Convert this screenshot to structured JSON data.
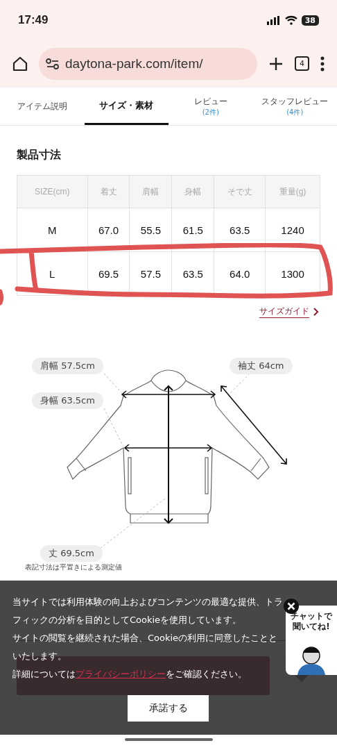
{
  "status_bar": {
    "time": "17:49",
    "battery": "38"
  },
  "browser": {
    "url": "daytona-park.com/item/",
    "tab_count": "4"
  },
  "tabs": [
    {
      "label": "アイテム説明",
      "selected": false
    },
    {
      "label": "サイズ・素材",
      "selected": true
    },
    {
      "label": "レビュー",
      "count": "(2件)",
      "selected": false
    },
    {
      "label": "スタッフレビュー",
      "count": "(4件)",
      "selected": false
    }
  ],
  "section_title": "製品寸法",
  "table": {
    "columns": [
      "SIZE(cm)",
      "着丈",
      "肩幅",
      "身幅",
      "そで丈",
      "重量(g)"
    ],
    "rows": [
      [
        "M",
        "67.0",
        "55.5",
        "61.5",
        "63.5",
        "1240"
      ],
      [
        "L",
        "69.5",
        "57.5",
        "63.5",
        "64.0",
        "1300"
      ]
    ]
  },
  "size_guide_link": "サイズガイド",
  "diagram_labels": [
    {
      "kind": "shoulder",
      "text": "肩幅 57.5cm"
    },
    {
      "kind": "sleeve",
      "text": "袖丈 64cm"
    },
    {
      "kind": "body",
      "text": "身幅 63.5cm"
    },
    {
      "kind": "length",
      "text": "丈 69.5cm"
    }
  ],
  "notes": [
    "表記寸法は平置きによる測定値"
  ],
  "cookie": {
    "lines": [
      "当サイトでは利用体験の向上およびコンテンツの最適な提供、トラフィックの分析を目的としてCookieを使用しています。",
      "サイトの閲覧を継続された場合、Cookieの利用に同意したことといたします。"
    ],
    "detail_before": "詳細については",
    "link": "プライバシーポリシー",
    "detail_after": "をご確認ください。",
    "accept": "承諾する"
  },
  "chat_widget": "チャットで聞いてね!"
}
